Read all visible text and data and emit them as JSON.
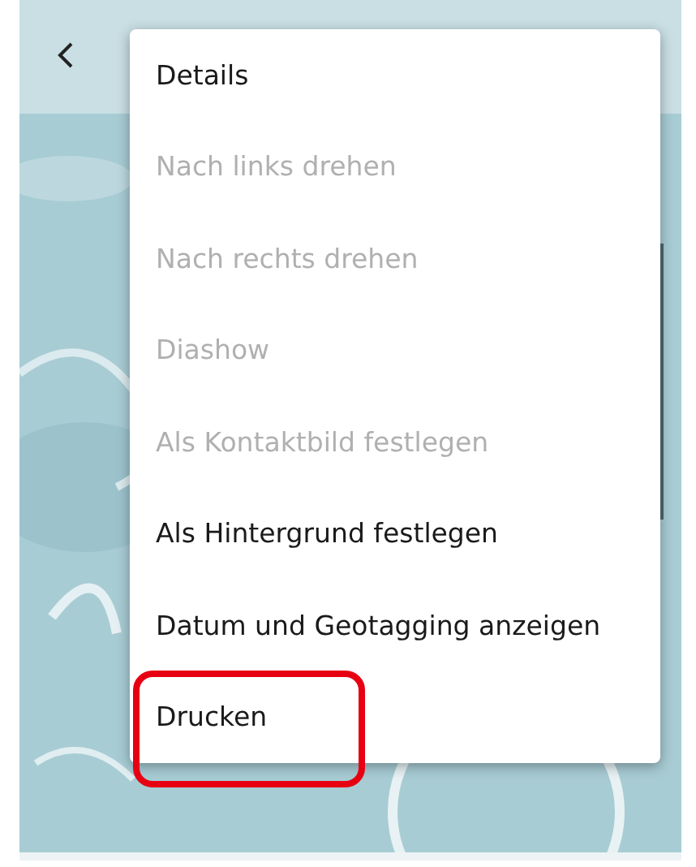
{
  "menu": {
    "items": [
      {
        "label": "Details",
        "disabled": false,
        "highlighted": false
      },
      {
        "label": "Nach links drehen",
        "disabled": true,
        "highlighted": false
      },
      {
        "label": "Nach rechts drehen",
        "disabled": true,
        "highlighted": false
      },
      {
        "label": "Diashow",
        "disabled": true,
        "highlighted": false
      },
      {
        "label": "Als Kontaktbild festlegen",
        "disabled": true,
        "highlighted": false
      },
      {
        "label": "Als Hintergrund festlegen",
        "disabled": false,
        "highlighted": false
      },
      {
        "label": "Datum und Geotagging anzeigen",
        "disabled": false,
        "highlighted": false
      },
      {
        "label": "Drucken",
        "disabled": false,
        "highlighted": true
      }
    ]
  }
}
